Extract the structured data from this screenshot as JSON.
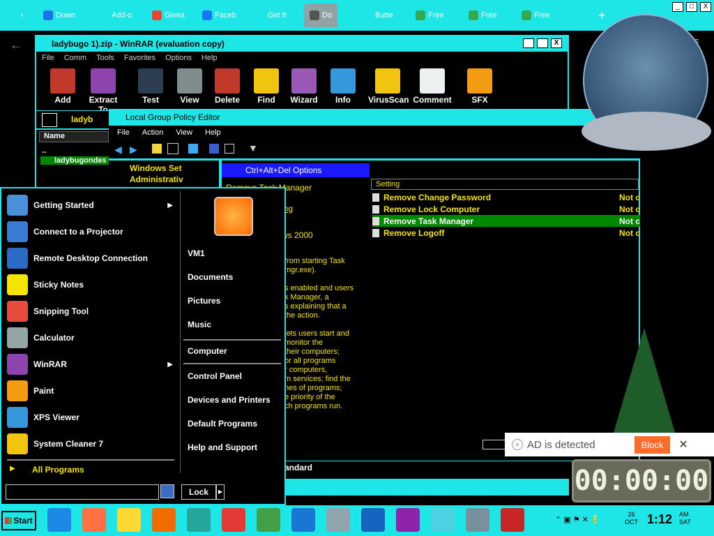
{
  "browser": {
    "tabs": [
      {
        "label": "Down",
        "color": "#1a73e8"
      },
      {
        "label": "Add-o",
        "color": "#1ee6e6"
      },
      {
        "label": "Givea",
        "color": "#ea4335"
      },
      {
        "label": "Faceb",
        "color": "#1877f2"
      },
      {
        "label": "Get fr",
        "color": "#1ee6e6"
      },
      {
        "label": "Do",
        "color": "#555555"
      },
      {
        "label": "Butte",
        "color": "#1ee6e6"
      },
      {
        "label": "Free",
        "color": "#34a853"
      },
      {
        "label": "Free",
        "color": "#34a853"
      },
      {
        "label": "Free",
        "color": "#34a853"
      }
    ],
    "new_tab_symbol": "+",
    "window_controls": [
      "_",
      "□",
      "X"
    ]
  },
  "winrar": {
    "title": "ladybugo            1).zip - WinRAR (evaluation copy)",
    "menu": [
      "File",
      "Comm",
      "Tools",
      "Favorites",
      "Options",
      "Help"
    ],
    "toolbar": [
      {
        "label": "Add",
        "color": "#c0392b"
      },
      {
        "label": "Extract To",
        "color": "#8e44ad"
      },
      {
        "label": "Test",
        "color": "#2c3e50"
      },
      {
        "label": "View",
        "color": "#7f8c8d"
      },
      {
        "label": "Delete",
        "color": "#c0392b"
      },
      {
        "label": "Find",
        "color": "#f1c40f"
      },
      {
        "label": "Wizard",
        "color": "#9b59b6"
      },
      {
        "label": "Info",
        "color": "#3498db"
      },
      {
        "label": "VirusScan",
        "color": "#f1c40f"
      },
      {
        "label": "Comment",
        "color": "#ecf0f1"
      },
      {
        "label": "SFX",
        "color": "#f39c12"
      }
    ],
    "path": "ladyb",
    "name_header": "Name",
    "files": [
      "..",
      "ladybugondes"
    ]
  },
  "gpedit": {
    "title": "Local Group Policy Editor",
    "menu": [
      "File",
      "Action",
      "View",
      "Help"
    ],
    "tree": [
      "Windows Set",
      "Administrativ"
    ],
    "header": "Ctrl+Alt+Del Options",
    "selected_policy": "Remove Task Manager",
    "link_text": "ing",
    "requirement": "ws 2000",
    "description_lines": [
      "from starting Task",
      "mgr.exe).",
      "",
      "s enabled and users",
      "k Manager, a",
      "s explaining that a",
      "the action.",
      "",
      "lets users start and",
      "monitor the",
      "their computers;",
      "or all programs",
      "r computers,",
      "m services; find the",
      "nes of programs;",
      "e priority of the",
      "ch programs run."
    ],
    "settings_header": "Setting",
    "settings": [
      {
        "name": "Remove Change Password",
        "state": "Not c"
      },
      {
        "name": "Remove Lock Computer",
        "state": "Not c"
      },
      {
        "name": "Remove Task Manager",
        "state": "Not c",
        "selected": true
      },
      {
        "name": "Remove Logoff",
        "state": "Not c"
      }
    ],
    "tab": "andard"
  },
  "startmenu": {
    "items": [
      {
        "label": "Getting Started",
        "arrow": true,
        "color": "#4a90d9"
      },
      {
        "label": "Connect to a Projector",
        "arrow": false,
        "color": "#3a7bd5"
      },
      {
        "label": "Remote Desktop Connection",
        "arrow": false,
        "color": "#2a6bc5"
      },
      {
        "label": "Sticky Notes",
        "arrow": false,
        "color": "#f5e400"
      },
      {
        "label": "Snipping Tool",
        "arrow": false,
        "color": "#e74c3c"
      },
      {
        "label": "Calculator",
        "arrow": false,
        "color": "#95a5a6"
      },
      {
        "label": "WinRAR",
        "arrow": true,
        "color": "#8e44ad"
      },
      {
        "label": "Paint",
        "arrow": false,
        "color": "#f39c12"
      },
      {
        "label": "XPS Viewer",
        "arrow": false,
        "color": "#3498db"
      },
      {
        "label": "System Cleaner 7",
        "arrow": false,
        "color": "#f1c40f"
      }
    ],
    "all_programs": "All Programs",
    "right_links": [
      "VM1",
      "Documents",
      "Pictures",
      "Music",
      "Computer",
      "Control Panel",
      "Devices and Printers",
      "Default Programs",
      "Help and Support"
    ],
    "search_placeholder": "",
    "lock_label": "Lock"
  },
  "taskbar": {
    "start_label": "Start",
    "apps": [
      "internet-explorer",
      "firefox",
      "file-explorer",
      "media-player",
      "browser",
      "opera",
      "winrar-archive",
      "browser-blue",
      "network",
      "search-app",
      "winrar",
      "notepad",
      "network-2",
      "toolbox"
    ],
    "app_colors": [
      "#1e88e5",
      "#ff7043",
      "#fdd835",
      "#ef6c00",
      "#26a69a",
      "#e53935",
      "#43a047",
      "#1976d2",
      "#90a4ae",
      "#1565c0",
      "#8e24aa",
      "#4dd0e1",
      "#78909c",
      "#c62828"
    ],
    "date_day": "26",
    "date_month": "OCT",
    "time": "1:12",
    "ampm": "AM",
    "weekday": "SAT"
  },
  "ad": {
    "text": "AD is detected",
    "block_label": "Block",
    "close": "✕"
  },
  "timer": {
    "display": "00:00:00"
  }
}
